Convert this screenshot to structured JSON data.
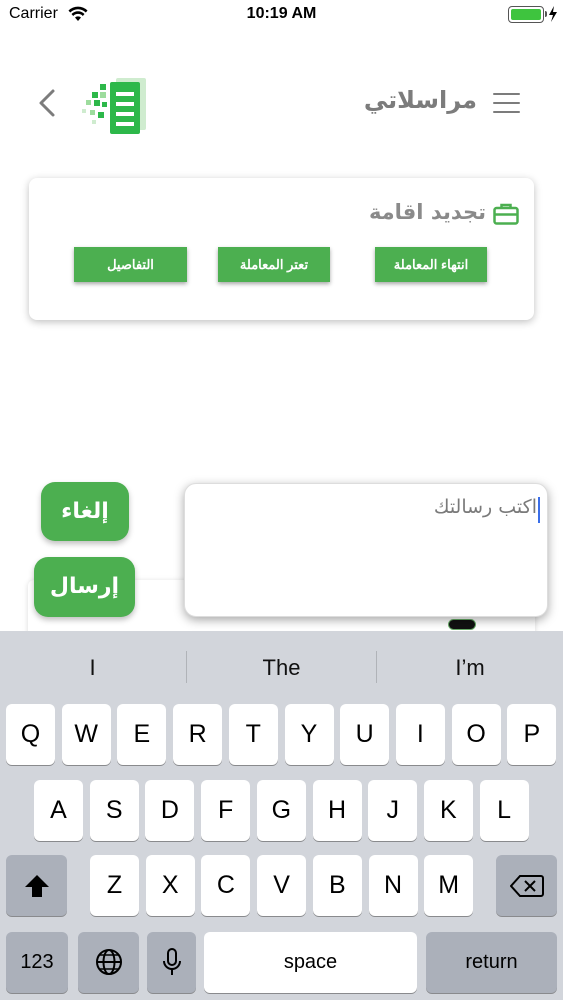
{
  "status_bar": {
    "carrier": "Carrier",
    "time": "10:19 AM"
  },
  "header": {
    "title": "مراسلاتي"
  },
  "card": {
    "title": "تجديد اقامة",
    "buttons": {
      "end": "انتهاء المعاملة",
      "stalled": "تعتر المعاملة",
      "details": "التفاصيل"
    }
  },
  "message": {
    "placeholder": "اكتب رسالتك",
    "cancel_label": "إلغاء",
    "send_label": "إرسال"
  },
  "keyboard": {
    "suggestions": [
      "I",
      "The",
      "I’m"
    ],
    "row1": [
      "Q",
      "W",
      "E",
      "R",
      "T",
      "Y",
      "U",
      "I",
      "O",
      "P"
    ],
    "row2": [
      "A",
      "S",
      "D",
      "F",
      "G",
      "H",
      "J",
      "K",
      "L"
    ],
    "row3": [
      "Z",
      "X",
      "C",
      "V",
      "B",
      "N",
      "M"
    ],
    "numbers_label": "123",
    "space_label": "space",
    "return_label": "return"
  },
  "colors": {
    "accent": "#4caf50",
    "title_gray": "#7c7c7c",
    "keyboard_bg": "#d2d5db"
  }
}
